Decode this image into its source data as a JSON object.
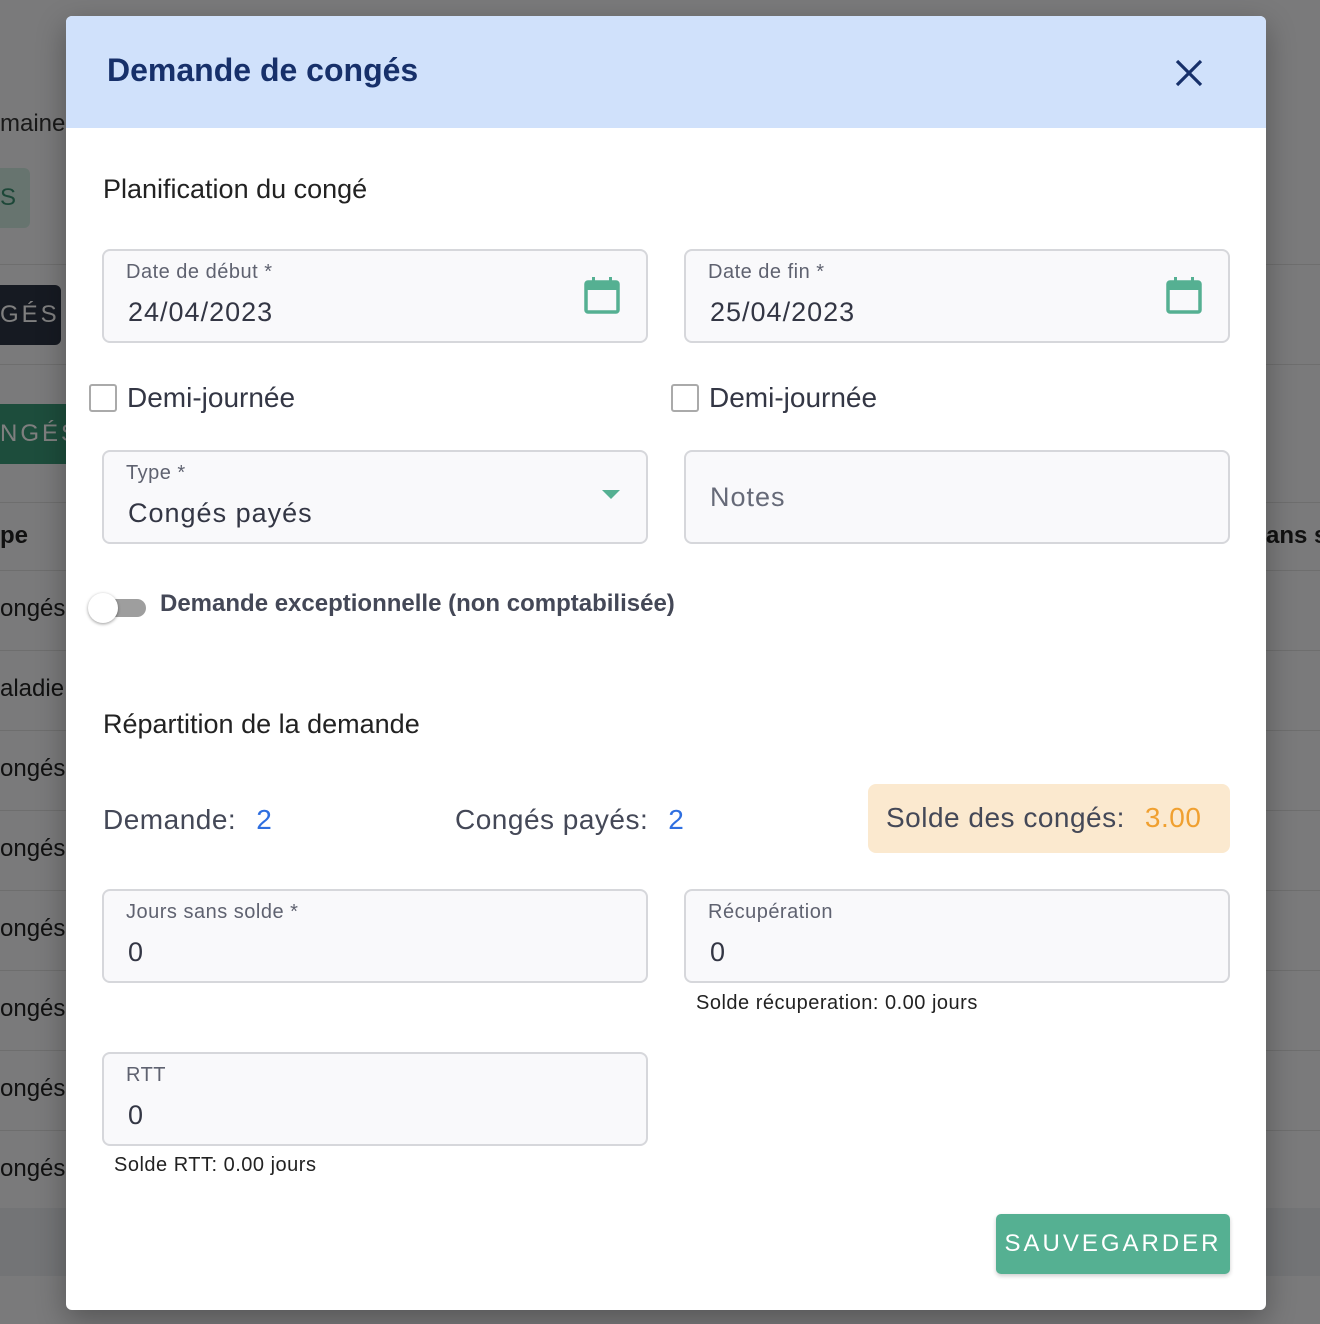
{
  "background": {
    "fragments": [
      "maine",
      "S",
      "GÉS",
      "NGÉS",
      "pe",
      "ans s"
    ],
    "rows": [
      "ongés",
      "aladie",
      "ongés",
      "ongés",
      "ongés",
      "ongés",
      "ongés",
      "ongés"
    ]
  },
  "modal": {
    "title": "Demande de congés",
    "close_icon": "close-icon",
    "planning_title": "Planification du congé",
    "start_date": {
      "label": "Date de début *",
      "value": "24/04/2023",
      "icon": "calendar-icon"
    },
    "end_date": {
      "label": "Date de fin *",
      "value": "25/04/2023",
      "icon": "calendar-icon"
    },
    "half_day_start": {
      "label": "Demi-journée",
      "checked": false
    },
    "half_day_end": {
      "label": "Demi-journée",
      "checked": false
    },
    "type": {
      "label": "Type *",
      "value": "Congés payés"
    },
    "notes": {
      "placeholder": "Notes",
      "value": ""
    },
    "exceptional": {
      "label": "Demande exceptionnelle (non comptabilisée)",
      "on": false
    },
    "distribution_title": "Répartition de la demande",
    "request": {
      "label": "Demande:",
      "value": "2"
    },
    "paid_leave": {
      "label": "Congés payés:",
      "value": "2"
    },
    "balance": {
      "label": "Solde des congés:",
      "value": "3.00"
    },
    "unpaid_days": {
      "label": "Jours sans solde *",
      "value": "0"
    },
    "recovery": {
      "label": "Récupération",
      "value": "0",
      "hint": "Solde récuperation: 0.00 jours"
    },
    "rtt": {
      "label": "RTT",
      "value": "0",
      "hint": "Solde RTT: 0.00 jours"
    },
    "save_label": "SAUVEGARDER",
    "colors": {
      "header": "#d0e1fb",
      "accent": "#55b092",
      "balance_bg": "#fbe9cf",
      "balance_value": "#f0a030",
      "number": "#2f6fe0"
    }
  }
}
